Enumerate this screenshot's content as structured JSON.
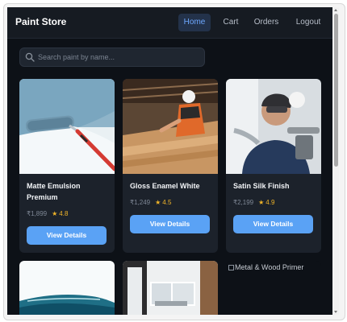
{
  "app": {
    "title": "Paint Store"
  },
  "nav": {
    "links": [
      {
        "label": "Home",
        "active": true
      },
      {
        "label": "Cart"
      },
      {
        "label": "Orders"
      },
      {
        "label": "Logout"
      }
    ]
  },
  "search": {
    "placeholder": "Search paint by name...",
    "value": "",
    "icon": "search-icon"
  },
  "products": [
    {
      "name": "Matte Emulsion Premium",
      "price": "₹1,899",
      "rating": "4.8",
      "button": "View Details",
      "image": "paint-roller-photo"
    },
    {
      "name": "Gloss Enamel White",
      "price": "₹1,249",
      "rating": "4.5",
      "button": "View Details",
      "image": "woodworking-photo"
    },
    {
      "name": "Satin Silk Finish",
      "price": "₹2,199",
      "rating": "4.9",
      "button": "View Details",
      "image": "painter-spraying-photo"
    },
    {
      "name": "",
      "image": "ocean-wave-photo"
    },
    {
      "name": "",
      "image": "modern-interior-photo"
    },
    {
      "name": "",
      "alt": "Metal & Wood Primer",
      "image": "broken-image"
    }
  ],
  "icons": {
    "star": "★"
  },
  "colors": {
    "background": "#0d1117",
    "card": "#1c222b",
    "accent": "#5aa2f5",
    "star": "#f0b429",
    "nav_active": "#6ea8ff"
  }
}
